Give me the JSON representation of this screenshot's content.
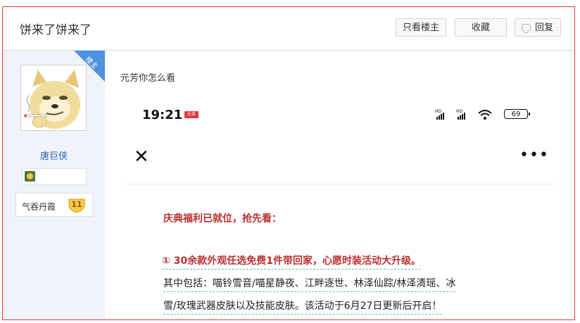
{
  "thread": {
    "title": "饼来了饼来了",
    "only_op_label": "只看楼主",
    "favorite_label": "收藏",
    "reply_label": "回复"
  },
  "author": {
    "op_badge": "楼主",
    "username": "唐巨侠",
    "level_name": "气吞丹霞",
    "level": "11",
    "avatar_icon": "shiba-dog-smoking-avatar",
    "accent": "#4f90e0"
  },
  "post": {
    "text": "元芳你怎么看"
  },
  "screenshot": {
    "time": "19:21",
    "battery": "69",
    "heading": "庆典福利已就位，抢先看：",
    "item1": "① 30余款外观任选免费1件带回家，心愿时装活动大升级。",
    "line2": "其中包括：喵铃雪音/喵星静夜、江畔逐世、林泽仙踪/林泽清瑶、冰",
    "line3": "雪/玫瑰武器皮肤以及技能皮肤。该活动于6月27日更新后开启！",
    "highlight_color": "#b93030"
  }
}
